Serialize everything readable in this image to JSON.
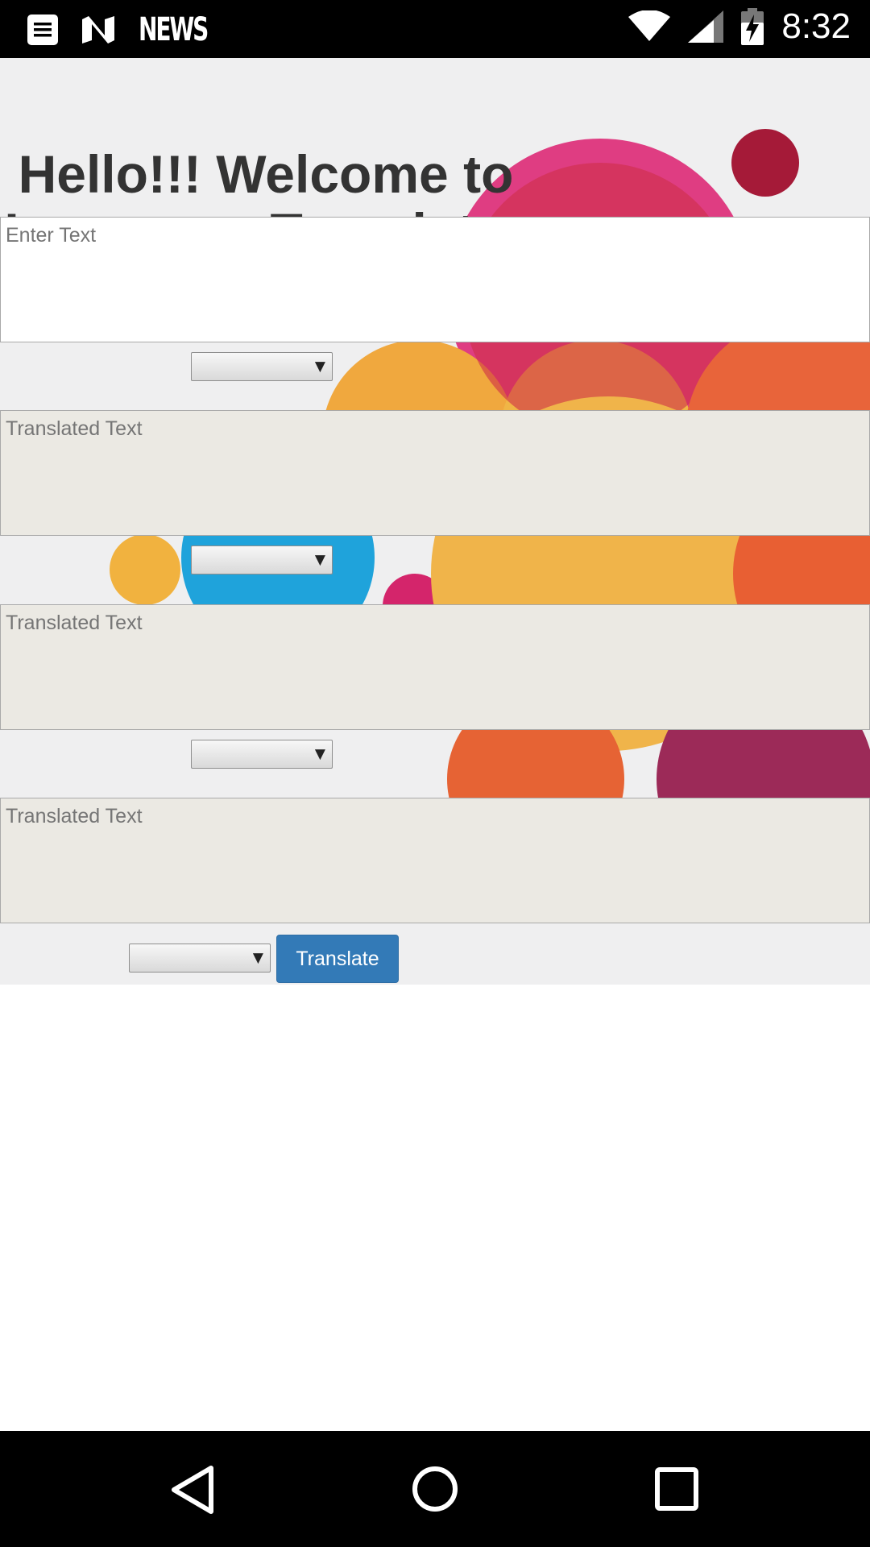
{
  "status_bar": {
    "time": "8:32",
    "news_label": "NEWS",
    "icons": [
      "menu-notification-icon",
      "n-logo-icon",
      "wifi-icon",
      "signal-icon",
      "battery-icon"
    ]
  },
  "app": {
    "title_line1": "Hello!!! Welcome to",
    "title_line2": "Language Translator",
    "input_placeholder": "Enter Text",
    "outputs": [
      {
        "placeholder": "Translated Text"
      },
      {
        "placeholder": "Translated Text"
      },
      {
        "placeholder": "Translated Text"
      }
    ],
    "selects": [
      {
        "selected": ""
      },
      {
        "selected": ""
      },
      {
        "selected": ""
      },
      {
        "selected": ""
      }
    ],
    "translate_label": "Translate"
  },
  "nav_bar": {
    "icons": [
      "back-icon",
      "home-icon",
      "recents-icon"
    ]
  }
}
